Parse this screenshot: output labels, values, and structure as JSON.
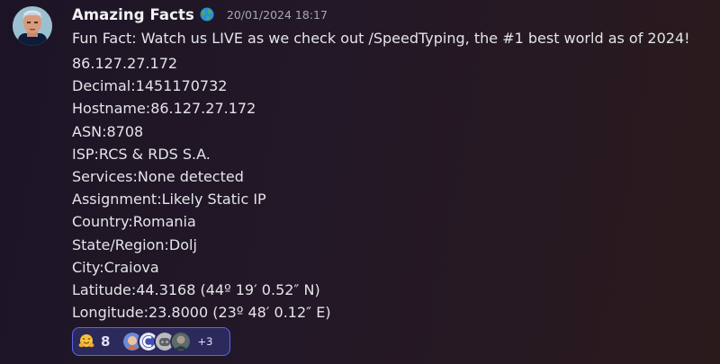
{
  "message": {
    "username": "Amazing Facts",
    "badge_icon": "globe-icon",
    "timestamp": "20/01/2024 18:17",
    "lines": [
      "Fun Fact: Watch us LIVE as we check out /SpeedTyping, the #1 best world as of 2024!",
      "86.127.27.172",
      "Decimal:1451170732",
      "Hostname:86.127.27.172",
      "ASN:8708",
      "ISP:RCS & RDS S.A.",
      "Services:None detected",
      "Assignment:Likely Static IP",
      "Country:Romania",
      "State/Region:Dolj",
      "City:Craiova",
      "Latitude:44.3168 (44º 19′ 0.52″ N)",
      "Longitude:23.8000 (23º 48′ 0.12″ E)"
    ]
  },
  "reaction": {
    "emoji_icon": "hugging-face-icon",
    "count": "8",
    "reactor_icons": [
      "reactor-avatar-1-icon",
      "reactor-avatar-2-icon",
      "reactor-avatar-3-icon",
      "reactor-avatar-4-icon"
    ],
    "more_label": "+3"
  },
  "colors": {
    "accent": "#5865f2",
    "reaction_bg": "#2c2a5a",
    "username": "#f2f3f5",
    "timestamp": "#a5a9b0",
    "text": "#e3e5e8"
  }
}
